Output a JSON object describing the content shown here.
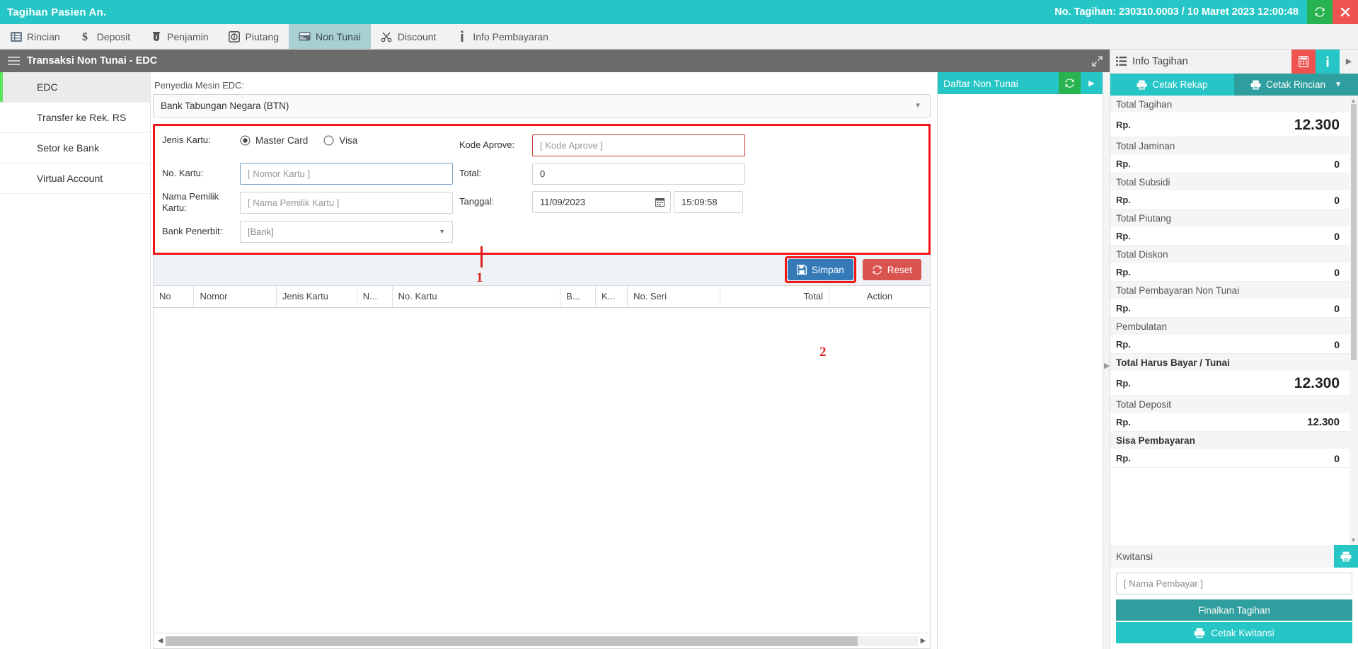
{
  "titlebar": {
    "title": "Tagihan Pasien An.",
    "bill_info": "No. Tagihan: 230310.0003 / 10 Maret 2023 12:00:48",
    "refresh_icon": "refresh-icon",
    "close_icon": "close-icon"
  },
  "tabs": [
    {
      "label": "Rincian",
      "icon": "list-icon",
      "active": false
    },
    {
      "label": "Deposit",
      "icon": "dollar-icon",
      "active": false
    },
    {
      "label": "Penjamin",
      "icon": "shield-icon",
      "active": false
    },
    {
      "label": "Piutang",
      "icon": "coin-icon",
      "active": false
    },
    {
      "label": "Non Tunai",
      "icon": "card-icon",
      "active": true
    },
    {
      "label": "Discount",
      "icon": "scissors-icon",
      "active": false
    },
    {
      "label": "Info Pembayaran",
      "icon": "info-icon",
      "active": false
    }
  ],
  "subheader": {
    "title": "Transaksi Non Tunai - EDC",
    "menu_icon": "hamburger-icon",
    "expand_icon": "expand-icon"
  },
  "leftnav": [
    {
      "label": "EDC",
      "active": true
    },
    {
      "label": "Transfer ke Rek. RS",
      "active": false
    },
    {
      "label": "Setor ke Bank",
      "active": false
    },
    {
      "label": "Virtual Account",
      "active": false
    }
  ],
  "form": {
    "provider_label": "Penyedia Mesin EDC:",
    "provider_value": "Bank Tabungan Negara (BTN)",
    "jenis_kartu_label": "Jenis Kartu:",
    "radio_master": "Master Card",
    "radio_visa": "Visa",
    "radio_selected": "Master Card",
    "no_kartu_label": "No. Kartu:",
    "no_kartu_placeholder": "[ Nomor Kartu ]",
    "nama_pemilik_label": "Nama Pemilik Kartu:",
    "nama_pemilik_placeholder": "[ Nama Pemilik Kartu ]",
    "bank_penerbit_label": "Bank Penerbit:",
    "bank_penerbit_value": "[Bank]",
    "kode_aprove_label": "Kode Aprove:",
    "kode_aprove_placeholder": "[ Kode Aprove ]",
    "total_label": "Total:",
    "total_value": "0",
    "tanggal_label": "Tanggal:",
    "tanggal_value": "11/09/2023",
    "waktu_value": "15:09:58",
    "calendar_icon": "calendar-icon"
  },
  "actions": {
    "save_label": "Simpan",
    "save_icon": "save-icon",
    "reset_label": "Reset",
    "reset_icon": "refresh-icon",
    "marker_1": "1",
    "marker_2": "2"
  },
  "table": {
    "columns": [
      "No",
      "Nomor",
      "Jenis Kartu",
      "N...",
      "No. Kartu",
      "B...",
      "K...",
      "No. Seri",
      "Total",
      "Action"
    ],
    "rows": []
  },
  "daftar": {
    "title": "Daftar Non Tunai",
    "refresh_icon": "refresh-icon",
    "expand_icon": "chevron-right-icon"
  },
  "info": {
    "header_title": "Info Tagihan",
    "header_icon": "list-icon",
    "calc_icon": "calculator-icon",
    "info_icon": "info-icon",
    "next_icon": "chevron-right-icon",
    "print_recap_label": "Cetak Rekap",
    "print_detail_label": "Cetak Rincian",
    "print_icon": "printer-icon",
    "currency": "Rp.",
    "rows": [
      {
        "label": "Total Tagihan",
        "value": "12.300",
        "bold": false,
        "size": "big"
      },
      {
        "label": "Total Jaminan",
        "value": "0",
        "bold": false,
        "size": "normal"
      },
      {
        "label": "Total Subsidi",
        "value": "0",
        "bold": false,
        "size": "normal"
      },
      {
        "label": "Total Piutang",
        "value": "0",
        "bold": false,
        "size": "normal"
      },
      {
        "label": "Total Diskon",
        "value": "0",
        "bold": false,
        "size": "normal"
      },
      {
        "label": "Total Pembayaran Non Tunai",
        "value": "0",
        "bold": false,
        "size": "normal"
      },
      {
        "label": "Pembulatan",
        "value": "0",
        "bold": false,
        "size": "normal"
      },
      {
        "label": "Total Harus Bayar / Tunai",
        "value": "12.300",
        "bold": true,
        "size": "big"
      },
      {
        "label": "Total Deposit",
        "value": "12.300",
        "bold": false,
        "size": "mid"
      },
      {
        "label": "Sisa Pembayaran",
        "value": "0",
        "bold": true,
        "size": "normal"
      }
    ],
    "kwitansi_label": "Kwitansi",
    "kwitansi_print_icon": "printer-icon",
    "payer_placeholder": "[ Nama Pembayar ]",
    "finalize_label": "Finalkan Tagihan",
    "print_receipt_label": "Cetak Kwitansi"
  },
  "colors": {
    "teal": "#26c6c6",
    "teal_dark": "#2e9e9e",
    "red": "#ef5350",
    "green": "#27b34f",
    "blue": "#337ab7",
    "marker_red": "#f31616"
  }
}
